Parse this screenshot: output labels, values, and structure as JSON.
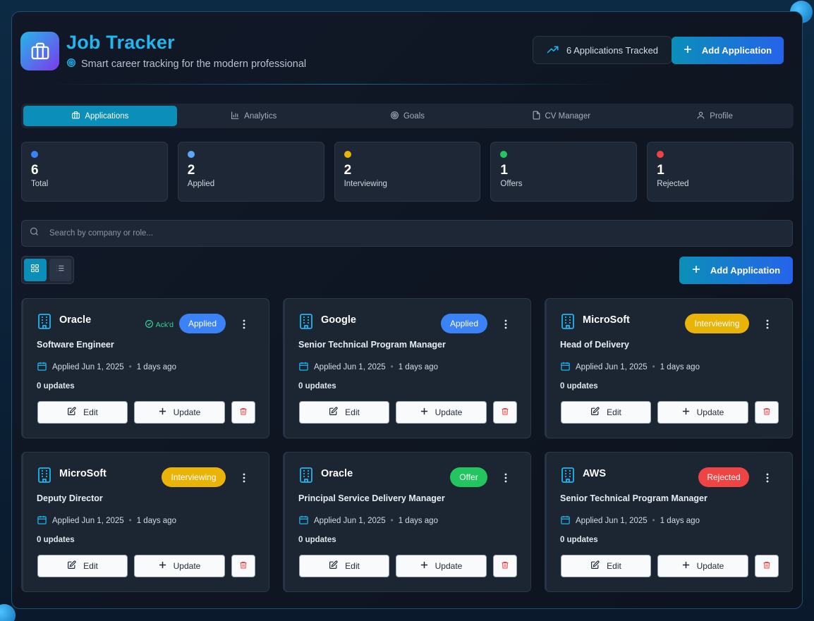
{
  "header": {
    "title": "Job Tracker",
    "subtitle": "Smart career tracking for the modern professional",
    "tracked_label": "6 Applications Tracked",
    "add_label": "Add Application"
  },
  "tabs": [
    {
      "label": "Applications",
      "icon": "briefcase-icon",
      "active": true
    },
    {
      "label": "Analytics",
      "icon": "bar-chart-icon"
    },
    {
      "label": "Goals",
      "icon": "target-icon"
    },
    {
      "label": "CV Manager",
      "icon": "file-icon"
    },
    {
      "label": "Profile",
      "icon": "user-icon"
    }
  ],
  "stats": [
    {
      "value": "6",
      "label": "Total",
      "color": "#3b82f6"
    },
    {
      "value": "2",
      "label": "Applied",
      "color": "#60a5fa"
    },
    {
      "value": "2",
      "label": "Interviewing",
      "color": "#eab308"
    },
    {
      "value": "1",
      "label": "Offers",
      "color": "#22c55e"
    },
    {
      "value": "1",
      "label": "Rejected",
      "color": "#ef4444"
    }
  ],
  "search": {
    "placeholder": "Search by company or role..."
  },
  "list_add_label": "Add Application",
  "card_labels": {
    "edit": "Edit",
    "update": "Update"
  },
  "cards": [
    {
      "company": "Oracle",
      "ack": "Ack'd",
      "status": "Applied",
      "status_color": "#3b82f6",
      "role": "Software Engineer",
      "applied": "Applied Jun 1, 2025",
      "ago": "1 days ago",
      "updates": "0 updates"
    },
    {
      "company": "Google",
      "status": "Applied",
      "status_color": "#3b82f6",
      "role": "Senior Technical Program Manager",
      "applied": "Applied Jun 1, 2025",
      "ago": "1 days ago",
      "updates": "0 updates"
    },
    {
      "company": "MicroSoft",
      "status": "Interviewing",
      "status_color": "#eab308",
      "role": "Head of Delivery",
      "applied": "Applied Jun 1, 2025",
      "ago": "1 days ago",
      "updates": "0 updates"
    },
    {
      "company": "MicroSoft",
      "status": "Interviewing",
      "status_color": "#eab308",
      "role": "Deputy Director",
      "applied": "Applied Jun 1, 2025",
      "ago": "1 days ago",
      "updates": "0 updates"
    },
    {
      "company": "Oracle",
      "status": "Offer",
      "status_color": "#22c55e",
      "role": "Principal Service Delivery Manager",
      "applied": "Applied Jun 1, 2025",
      "ago": "1 days ago",
      "updates": "0 updates"
    },
    {
      "company": "AWS",
      "status": "Rejected",
      "status_color": "#ef4444",
      "role": "Senior Technical Program Manager",
      "applied": "Applied Jun 1, 2025",
      "ago": "1 days ago",
      "updates": "0 updates"
    }
  ]
}
